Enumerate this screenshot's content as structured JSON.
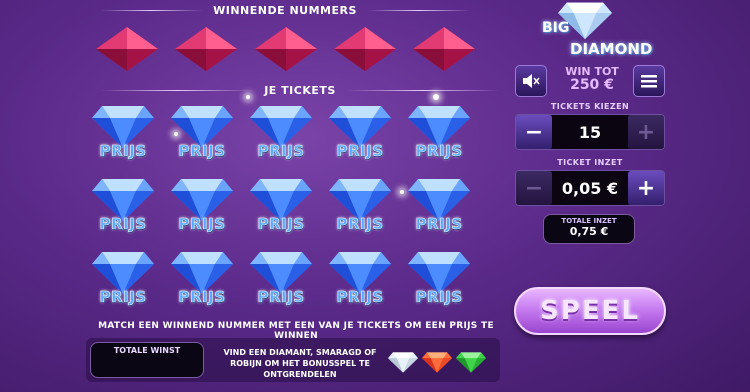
{
  "headings": {
    "winning_numbers": "WINNENDE NUMMERS",
    "tickets": "JE TICKETS"
  },
  "winning_gems": [
    "ruby-icon",
    "ruby-icon",
    "ruby-icon",
    "ruby-icon",
    "ruby-icon"
  ],
  "tickets": {
    "count": 15,
    "label": "PRIJS",
    "icon": "blue-diamond-icon"
  },
  "instruction": "MATCH EEN WINNEND NUMMER MET EEN VAN JE TICKETS OM EEN PRIJS TE WINNEN",
  "total_win": {
    "label": "TOTALE WINST",
    "value": ""
  },
  "bonus": {
    "text": "VIND EEN DIAMANT, SMARAGD OF ROBIJN OM HET BONUSSPEL TE ONTGRENDELEN",
    "gems": [
      "diamond-icon",
      "ruby-icon",
      "emerald-icon"
    ]
  },
  "logo": {
    "line1": "BIG",
    "line2": "DIAMOND"
  },
  "win_tot": {
    "label": "WIN TOT",
    "value": "250 €"
  },
  "tickets_kiezen": {
    "label": "TICKETS KIEZEN",
    "value": "15"
  },
  "ticket_inzet": {
    "label": "TICKET INZET",
    "value": "0,05 €"
  },
  "totale_inzet": {
    "label": "TOTALE INZET",
    "value": "0,75 €"
  },
  "play_button": "SPEEL",
  "colors": {
    "ruby": "#c8245e",
    "diamond": "#3a78ff",
    "emerald": "#2fbf3a",
    "play": "#c67cf0"
  }
}
